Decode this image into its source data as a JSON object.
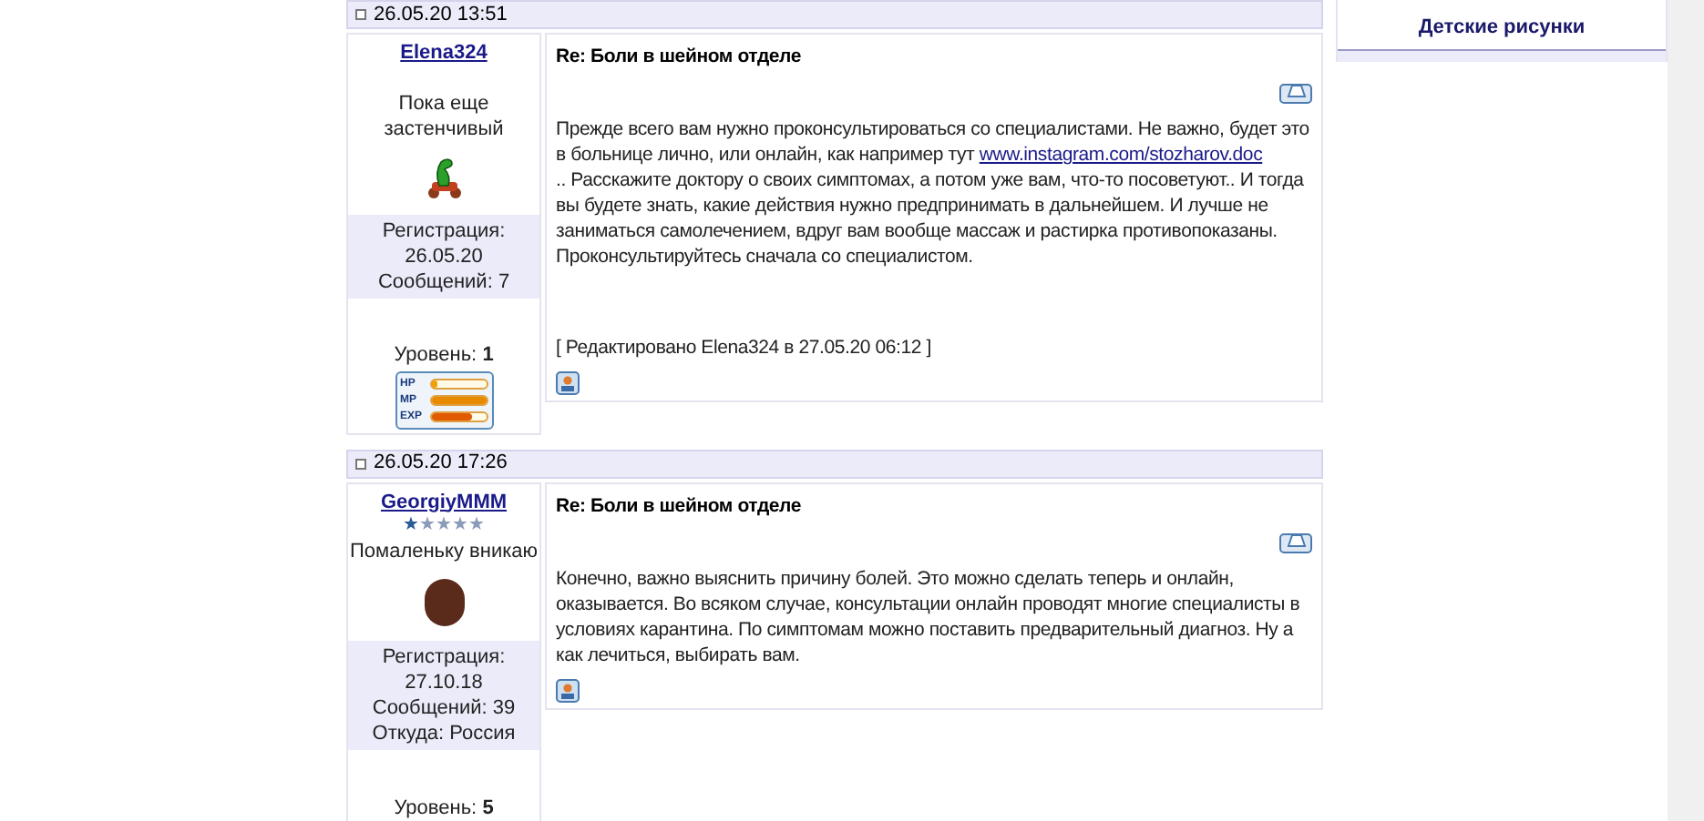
{
  "posts": [
    {
      "date": "26.05.20 13:51",
      "author": "Elena324",
      "status": "Пока еще застенчивый",
      "avatar": {
        "kind": "dinosaur"
      },
      "registration_label": "Регистрация:",
      "registration_date": "26.05.20",
      "messages": "Сообщений: 7",
      "level_label": "Уровень:",
      "level_value": "1",
      "stats": [
        {
          "label": "HP",
          "level": 0.1
        },
        {
          "label": "MP",
          "level": 1
        },
        {
          "label": "EXP",
          "level": 0.75
        }
      ],
      "title": "Re: Боли в шейном отделе",
      "body_before": "Прежде всего вам нужно проконсультироваться со специалистами. Не важно, будет это в больнице лично, или онлайн, как например тут ",
      "link": "www.instagram.com/stozharov.doc",
      "body_after": ".. Расскажите доктору о своих симптомах, а потом уже вам, что-то посоветуют.. И тогда вы будете знать, какие действия нужно предпринимать в дальнейшем. И лучше не заниматься самолечением, вдруг вам вообще массаж и растирка противопоказаны. Проконсультируйтесь сначала со специалистом.",
      "edit_note": "[ Редактировано Elena324 в 27.05.20 06:12 ]"
    },
    {
      "date": "26.05.20 17:26",
      "author": "GeorgiyMMM",
      "stars": 1,
      "status": "Помаленьку вникаю",
      "avatar": {
        "kind": "photo"
      },
      "registration_label": "Регистрация:",
      "registration_date": "27.10.18",
      "messages": "Сообщений: 39",
      "location": "Откуда: Россия",
      "level_label": "Уровень:",
      "level_value": "5",
      "title": "Re: Боли в шейном отделе",
      "body_before": "Конечно, важно выяснить причину болей. Это можно сделать теперь и онлайн, оказывается. Во всяком случае, консультации онлайн проводят многие специалисты в условиях карантина. По симптомам можно поставить предварительный диагноз. Ну а как лечиться, выбирать вам."
    }
  ],
  "sidebar": {
    "link": "Детские рисунки"
  }
}
